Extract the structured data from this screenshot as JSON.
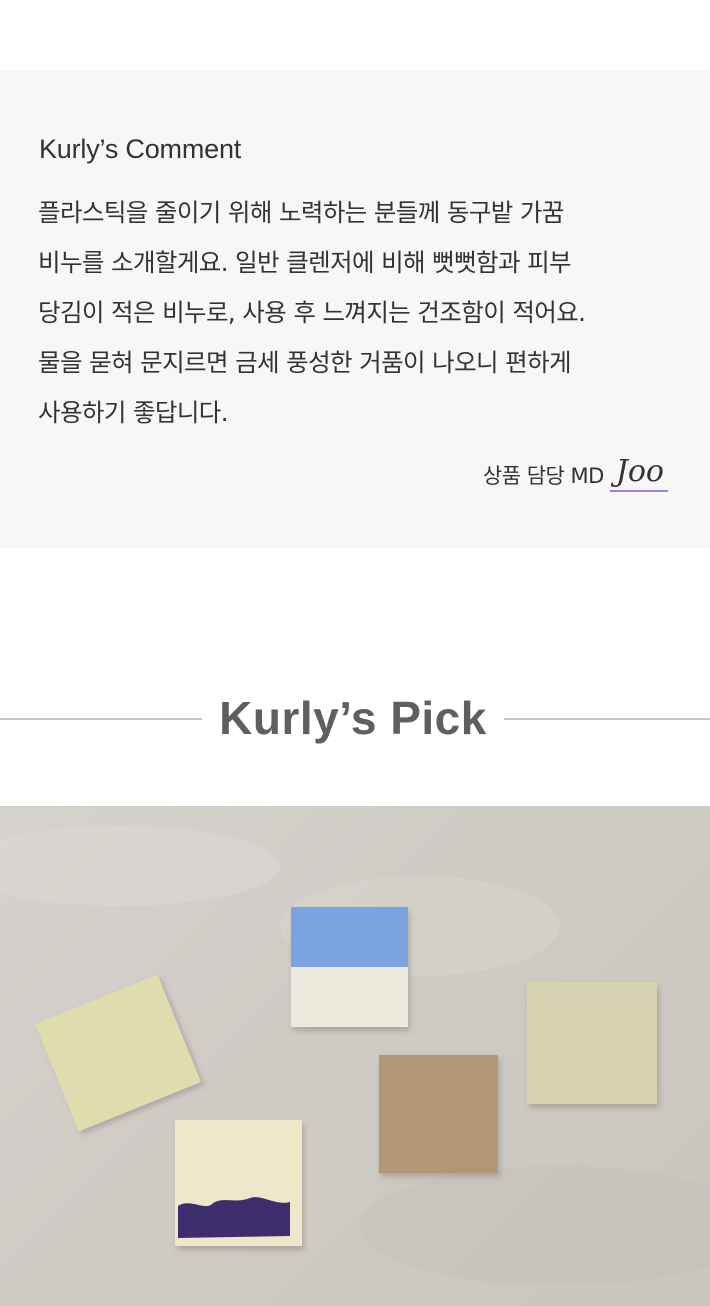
{
  "comment": {
    "title": "Kurly’s Comment",
    "lines": [
      "플라스틱을 줄이기 위해 노력하는 분들께 동구밭 가꿈",
      "비누를 소개할게요. 일반 클렌저에 비해 뻣뻣함과 피부",
      "당김이 적은 비누로, 사용 후 느껴지는 건조함이 적어요.",
      "물을 묻혀 문지르면 금세 풍성한 거품이 나오니 편하게",
      "사용하기 좋답니다."
    ],
    "signature_role": "상품 담당 MD",
    "signature_name": "Joo"
  },
  "pick": {
    "title": "Kurly’s Pick"
  },
  "colors": {
    "accent_underline": "#a57cd6",
    "comment_bg": "#f7f7f7"
  }
}
